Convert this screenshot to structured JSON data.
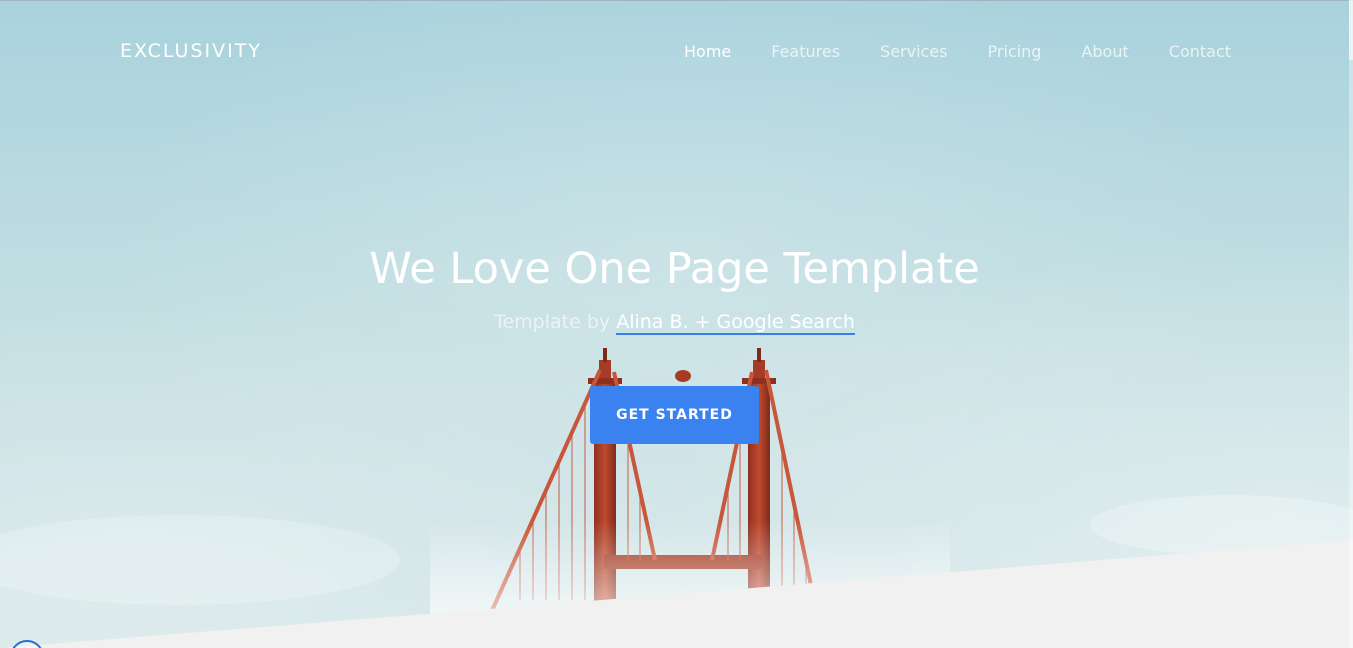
{
  "brand": {
    "logo_text": "EXCLUSIVITY"
  },
  "nav": {
    "items": [
      {
        "label": "Home",
        "active": true
      },
      {
        "label": "Features",
        "active": false
      },
      {
        "label": "Services",
        "active": false
      },
      {
        "label": "Pricing",
        "active": false
      },
      {
        "label": "About",
        "active": false
      },
      {
        "label": "Contact",
        "active": false
      }
    ]
  },
  "hero": {
    "headline": "We Love One Page Template",
    "subline_prefix": "Template by",
    "credit_link": "Alina B. + Google Search",
    "cta_label": "GET STARTED"
  },
  "colors": {
    "accent": "#3b82f1",
    "sky": "#b9dae0",
    "bridge": "#c0452c",
    "footer_band": "#f1f1f1"
  },
  "icons": {
    "corner_widget": "circle-badge-icon"
  }
}
